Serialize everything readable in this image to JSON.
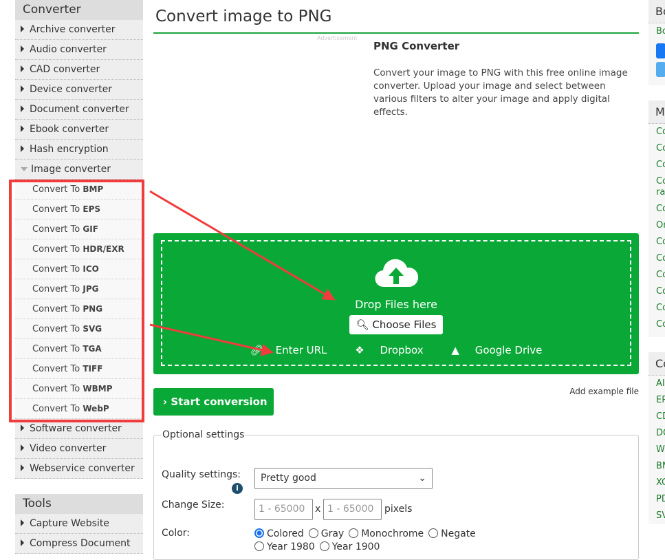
{
  "sidebar": {
    "converter_title": "Converter",
    "items_top": [
      "Archive converter",
      "Audio converter",
      "CAD converter",
      "Device converter",
      "Document converter",
      "Ebook converter",
      "Hash encryption"
    ],
    "image_converter": "Image converter",
    "sub_prefix": "Convert To",
    "sub_items": [
      "BMP",
      "EPS",
      "GIF",
      "HDR/EXR",
      "ICO",
      "JPG",
      "PNG",
      "SVG",
      "TGA",
      "TIFF",
      "WBMP",
      "WebP"
    ],
    "items_bottom": [
      "Software converter",
      "Video converter",
      "Webservice converter"
    ],
    "tools_title": "Tools",
    "tools_items": [
      "Capture Website",
      "Compress Document"
    ]
  },
  "main": {
    "title": "Convert image to PNG",
    "ad_label": "Advertisement",
    "info_title": "PNG Converter",
    "info_text": "Convert your image to PNG with this free online image converter. Upload your image and select between various filters to alter your image and apply digital effects.",
    "drop_text": "Drop Files here",
    "choose_files": "Choose Files",
    "enter_url": "Enter URL",
    "dropbox": "Dropbox",
    "google_drive": "Google Drive",
    "start": "Start conversion",
    "add_example": "Add example file",
    "optional": {
      "legend": "Optional settings",
      "quality_label": "Quality settings:",
      "quality_value": "Pretty good",
      "size_label": "Change Size:",
      "width_placeholder": "1 - 65000",
      "height_placeholder": "1 - 65000",
      "x": "x",
      "pixels": "pixels",
      "color_label": "Color:",
      "color_options": [
        "Colored",
        "Gray",
        "Monochrome",
        "Negate",
        "Year 1980",
        "Year 1900"
      ],
      "color_selected": "Colored"
    }
  },
  "right": {
    "box1_title": "Bo",
    "box1_text": "Bo",
    "box2_title": "M",
    "box2_links": [
      "Co",
      "Co",
      "Co",
      "Co",
      "ra",
      "Co",
      "On",
      "Co",
      "Co",
      "Co",
      "Co",
      "Co",
      "Co"
    ],
    "box3_title": "Co",
    "box3_links": [
      "AI",
      "EP",
      "CD",
      "DO",
      "W",
      "BM",
      "XC",
      "PD",
      "SV"
    ]
  },
  "colors": {
    "accent": "#0aa836",
    "annotation": "#f03c3c"
  }
}
